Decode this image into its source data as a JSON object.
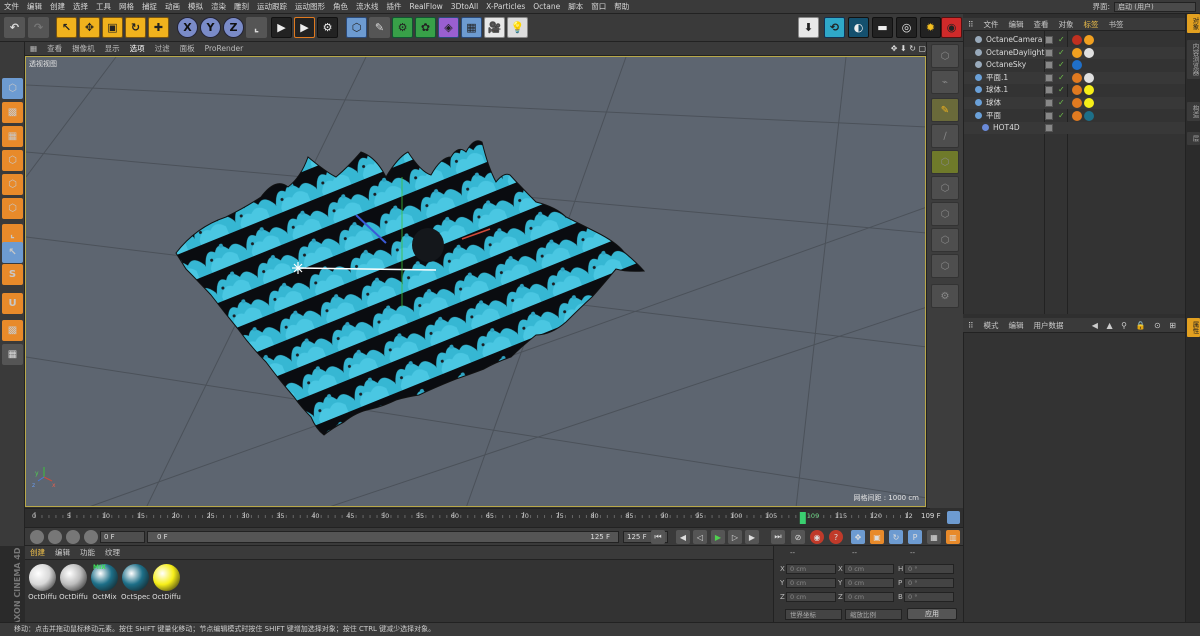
{
  "menu": [
    "文件",
    "编辑",
    "创建",
    "选择",
    "工具",
    "网格",
    "捕捉",
    "动画",
    "模拟",
    "渲染",
    "雕刻",
    "运动跟踪",
    "运动图形",
    "角色",
    "流水线",
    "插件",
    "RealFlow",
    "3DtoAll",
    "X-Particles",
    "Octane",
    "脚本",
    "窗口",
    "帮助"
  ],
  "layout": {
    "label": "界面:",
    "value": "启动 (用户)"
  },
  "toolbar": {
    "x": "X",
    "y": "Y",
    "z": "Z"
  },
  "viewport": {
    "menu": [
      "查看",
      "摄像机",
      "显示",
      "选项",
      "过滤",
      "面板",
      "ProRender"
    ],
    "active_menu": "选项",
    "title": "透视视图",
    "grid_info": "网格间距 : 1000 cm",
    "nav_icons": "✥ ⬇ ↻ ▢"
  },
  "timeline": {
    "ticks": [
      "0",
      "5",
      "10",
      "15",
      "20",
      "25",
      "30",
      "35",
      "40",
      "45",
      "50",
      "55",
      "60",
      "65",
      "70",
      "75",
      "80",
      "85",
      "90",
      "95",
      "100",
      "105",
      "109",
      "115",
      "120",
      "12"
    ],
    "current_frame": "109",
    "frame_end_label": "109 F"
  },
  "playback": {
    "start_field": "0 F",
    "slider_left": "0 F",
    "slider_right": "125 F",
    "end_field": "125 F"
  },
  "material_tabs": [
    "创建",
    "编辑",
    "功能",
    "纹理"
  ],
  "active_material_tab": "创建",
  "materials": [
    {
      "label": "OctDiffu",
      "color": "#d8d8d8"
    },
    {
      "label": "OctDiffu",
      "color": "#bdbdbd"
    },
    {
      "label": "OctMix",
      "color": "#1d6f88",
      "badge": "MIX"
    },
    {
      "label": "OctSpec",
      "color": "#1d6f88"
    },
    {
      "label": "OctDiffu",
      "color": "#f6ee18"
    }
  ],
  "coordinates": {
    "header": [
      "--",
      "--",
      "--"
    ],
    "rows": [
      {
        "a": "X",
        "av": "0 cm",
        "b": "X",
        "bv": "0 cm",
        "c": "H",
        "cv": "0 °"
      },
      {
        "a": "Y",
        "av": "0 cm",
        "b": "Y",
        "bv": "0 cm",
        "c": "P",
        "cv": "0 °"
      },
      {
        "a": "Z",
        "av": "0 cm",
        "b": "Z",
        "bv": "0 cm",
        "c": "B",
        "cv": "0 °"
      }
    ],
    "mode1": "世界坐标",
    "mode2": "缩放比例",
    "apply": "应用"
  },
  "status": "移动：点击并拖动鼠标移动元素。按住 SHIFT 键量化移动；节点编辑模式时按住 SHIFT 键增加选择对象；按住 CTRL 键减少选择对象。",
  "object_manager": {
    "tabs": [
      "文件",
      "编辑",
      "查看",
      "对象",
      "标签",
      "书签"
    ],
    "active_tab": "标签",
    "objects": [
      {
        "name": "OctaneCamera",
        "icon_color": "#9ab",
        "tags": [
          "#c03020",
          "#f0a020"
        ]
      },
      {
        "name": "OctaneDaylight",
        "icon_color": "#9ab",
        "tags": [
          "#f0a020",
          "#e0e0e0"
        ]
      },
      {
        "name": "OctaneSky",
        "icon_color": "#9ab",
        "tags": [
          "#1f6fc8"
        ]
      },
      {
        "name": "平面.1",
        "icon_color": "#6aa0d8",
        "tags": [
          "#e07a20",
          "#e0e0e0"
        ]
      },
      {
        "name": "球体.1",
        "icon_color": "#6aa0d8",
        "tags": [
          "#e07a20",
          "#f6ee18"
        ]
      },
      {
        "name": "球体",
        "icon_color": "#6aa0d8",
        "tags": [
          "#e07a20",
          "#f6ee18"
        ]
      },
      {
        "name": "平面",
        "icon_color": "#6aa0d8",
        "tags": [
          "#e07a20",
          "#1d6f88"
        ]
      },
      {
        "name": "HOT4D",
        "icon_color": "#6a8ad8",
        "tags": []
      }
    ]
  },
  "attributes": {
    "tabs": [
      "模式",
      "编辑",
      "用户数据"
    ]
  },
  "side_tabs": [
    "对象",
    "内容浏览器",
    "构造",
    "层"
  ],
  "side_tabs_lower": [
    "属性"
  ]
}
